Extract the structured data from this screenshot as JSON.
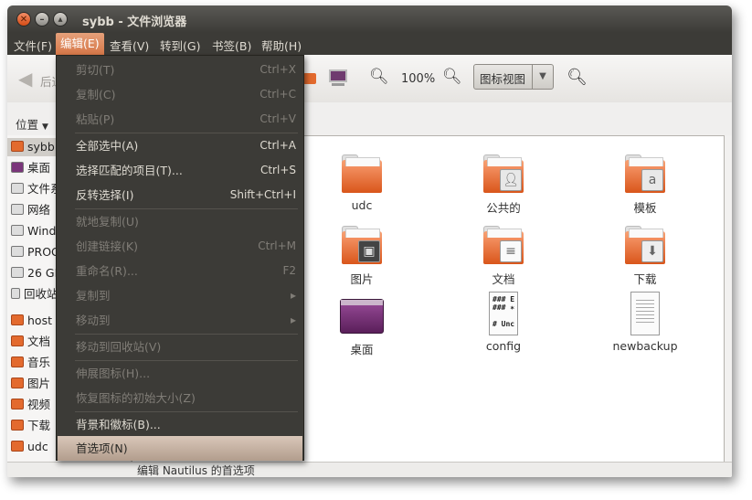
{
  "window": {
    "title": "sybb - 文件浏览器"
  },
  "menubar": [
    {
      "label": "文件(F)"
    },
    {
      "label": "编辑(E)"
    },
    {
      "label": "查看(V)"
    },
    {
      "label": "转到(G)"
    },
    {
      "label": "书签(B)"
    },
    {
      "label": "帮助(H)"
    }
  ],
  "toolbar": {
    "back_label": "后退",
    "zoom": "100%",
    "view_mode": "图标视图"
  },
  "location": {
    "label": "位置"
  },
  "sidebar": {
    "items": [
      {
        "label": "sybb"
      },
      {
        "label": "桌面"
      },
      {
        "label": "文件系统"
      },
      {
        "label": "网络"
      },
      {
        "label": "Windows"
      },
      {
        "label": "PROG"
      },
      {
        "label": "26 GB"
      },
      {
        "label": "回收站"
      },
      {
        "label": "host"
      },
      {
        "label": "文档"
      },
      {
        "label": "音乐"
      },
      {
        "label": "图片"
      },
      {
        "label": "视频"
      },
      {
        "label": "下载"
      },
      {
        "label": "udc"
      }
    ]
  },
  "files": [
    {
      "name": "udc",
      "icon": "folder-icon"
    },
    {
      "name": "公共的",
      "icon": "folder-public-icon"
    },
    {
      "name": "模板",
      "icon": "folder-templates-icon"
    },
    {
      "name": "图片",
      "icon": "folder-pictures-icon"
    },
    {
      "name": "文档",
      "icon": "folder-documents-icon"
    },
    {
      "name": "下载",
      "icon": "folder-download-icon"
    },
    {
      "name": "桌面",
      "icon": "desktop-icon"
    },
    {
      "name": "config",
      "icon": "text-file-icon",
      "preview": "### E\n### ∗\n\n# Unc"
    },
    {
      "name": "newbackup",
      "icon": "text-file-icon"
    }
  ],
  "edit_menu": {
    "items": [
      {
        "label": "剪切(T)",
        "shortcut": "Ctrl+X"
      },
      {
        "label": "复制(C)",
        "shortcut": "Ctrl+C"
      },
      {
        "label": "粘贴(P)",
        "shortcut": "Ctrl+V"
      },
      {
        "label": "全部选中(A)",
        "shortcut": "Ctrl+A"
      },
      {
        "label": "选择匹配的项目(T)...",
        "shortcut": "Ctrl+S"
      },
      {
        "label": "反转选择(I)",
        "shortcut": "Shift+Ctrl+I"
      },
      {
        "label": "就地复制(U)",
        "shortcut": ""
      },
      {
        "label": "创建链接(K)",
        "shortcut": "Ctrl+M"
      },
      {
        "label": "重命名(R)...",
        "shortcut": "F2"
      },
      {
        "label": "复制到",
        "shortcut": "▸"
      },
      {
        "label": "移动到",
        "shortcut": "▸"
      },
      {
        "label": "移动到回收站(V)",
        "shortcut": ""
      },
      {
        "label": "伸展图标(H)...",
        "shortcut": ""
      },
      {
        "label": "恢复图标的初始大小(Z)",
        "shortcut": ""
      },
      {
        "label": "背景和徽标(B)...",
        "shortcut": ""
      },
      {
        "label": "首选项(N)",
        "shortcut": ""
      }
    ]
  },
  "statusbar": {
    "text": "编辑 Nautilus 的首选项"
  }
}
